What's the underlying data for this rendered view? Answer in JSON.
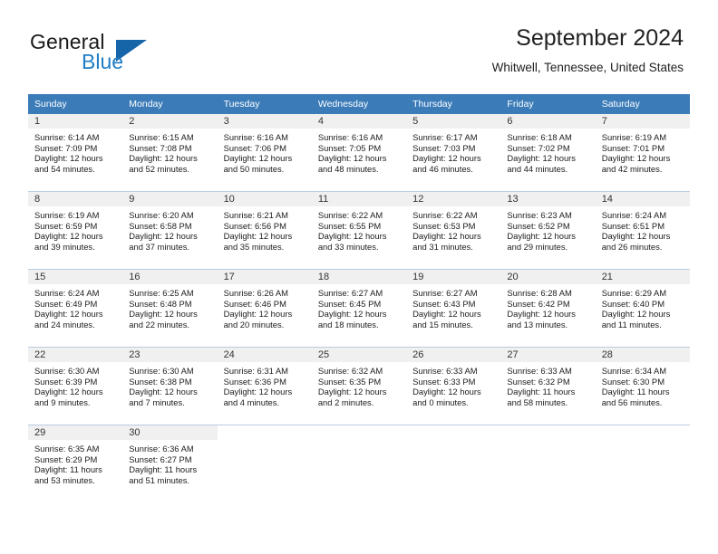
{
  "brand": {
    "word_one": "General",
    "word_two": "Blue",
    "logo_icon": "triangle-logo-icon",
    "accent_color": "#1f7dc4",
    "logo_color": "#1565a8"
  },
  "header": {
    "title": "September 2024",
    "subtitle": "Whitwell, Tennessee, United States"
  },
  "calendar": {
    "header_bg": "#3b7cb8",
    "daynum_bg": "#f0f0f0",
    "grid_line_color": "#b9cde0",
    "weekdays": [
      "Sunday",
      "Monday",
      "Tuesday",
      "Wednesday",
      "Thursday",
      "Friday",
      "Saturday"
    ],
    "weeks": [
      [
        {
          "day": "1",
          "sunrise": "Sunrise: 6:14 AM",
          "sunset": "Sunset: 7:09 PM",
          "daylight_line1": "Daylight: 12 hours",
          "daylight_line2": "and 54 minutes."
        },
        {
          "day": "2",
          "sunrise": "Sunrise: 6:15 AM",
          "sunset": "Sunset: 7:08 PM",
          "daylight_line1": "Daylight: 12 hours",
          "daylight_line2": "and 52 minutes."
        },
        {
          "day": "3",
          "sunrise": "Sunrise: 6:16 AM",
          "sunset": "Sunset: 7:06 PM",
          "daylight_line1": "Daylight: 12 hours",
          "daylight_line2": "and 50 minutes."
        },
        {
          "day": "4",
          "sunrise": "Sunrise: 6:16 AM",
          "sunset": "Sunset: 7:05 PM",
          "daylight_line1": "Daylight: 12 hours",
          "daylight_line2": "and 48 minutes."
        },
        {
          "day": "5",
          "sunrise": "Sunrise: 6:17 AM",
          "sunset": "Sunset: 7:03 PM",
          "daylight_line1": "Daylight: 12 hours",
          "daylight_line2": "and 46 minutes."
        },
        {
          "day": "6",
          "sunrise": "Sunrise: 6:18 AM",
          "sunset": "Sunset: 7:02 PM",
          "daylight_line1": "Daylight: 12 hours",
          "daylight_line2": "and 44 minutes."
        },
        {
          "day": "7",
          "sunrise": "Sunrise: 6:19 AM",
          "sunset": "Sunset: 7:01 PM",
          "daylight_line1": "Daylight: 12 hours",
          "daylight_line2": "and 42 minutes."
        }
      ],
      [
        {
          "day": "8",
          "sunrise": "Sunrise: 6:19 AM",
          "sunset": "Sunset: 6:59 PM",
          "daylight_line1": "Daylight: 12 hours",
          "daylight_line2": "and 39 minutes."
        },
        {
          "day": "9",
          "sunrise": "Sunrise: 6:20 AM",
          "sunset": "Sunset: 6:58 PM",
          "daylight_line1": "Daylight: 12 hours",
          "daylight_line2": "and 37 minutes."
        },
        {
          "day": "10",
          "sunrise": "Sunrise: 6:21 AM",
          "sunset": "Sunset: 6:56 PM",
          "daylight_line1": "Daylight: 12 hours",
          "daylight_line2": "and 35 minutes."
        },
        {
          "day": "11",
          "sunrise": "Sunrise: 6:22 AM",
          "sunset": "Sunset: 6:55 PM",
          "daylight_line1": "Daylight: 12 hours",
          "daylight_line2": "and 33 minutes."
        },
        {
          "day": "12",
          "sunrise": "Sunrise: 6:22 AM",
          "sunset": "Sunset: 6:53 PM",
          "daylight_line1": "Daylight: 12 hours",
          "daylight_line2": "and 31 minutes."
        },
        {
          "day": "13",
          "sunrise": "Sunrise: 6:23 AM",
          "sunset": "Sunset: 6:52 PM",
          "daylight_line1": "Daylight: 12 hours",
          "daylight_line2": "and 29 minutes."
        },
        {
          "day": "14",
          "sunrise": "Sunrise: 6:24 AM",
          "sunset": "Sunset: 6:51 PM",
          "daylight_line1": "Daylight: 12 hours",
          "daylight_line2": "and 26 minutes."
        }
      ],
      [
        {
          "day": "15",
          "sunrise": "Sunrise: 6:24 AM",
          "sunset": "Sunset: 6:49 PM",
          "daylight_line1": "Daylight: 12 hours",
          "daylight_line2": "and 24 minutes."
        },
        {
          "day": "16",
          "sunrise": "Sunrise: 6:25 AM",
          "sunset": "Sunset: 6:48 PM",
          "daylight_line1": "Daylight: 12 hours",
          "daylight_line2": "and 22 minutes."
        },
        {
          "day": "17",
          "sunrise": "Sunrise: 6:26 AM",
          "sunset": "Sunset: 6:46 PM",
          "daylight_line1": "Daylight: 12 hours",
          "daylight_line2": "and 20 minutes."
        },
        {
          "day": "18",
          "sunrise": "Sunrise: 6:27 AM",
          "sunset": "Sunset: 6:45 PM",
          "daylight_line1": "Daylight: 12 hours",
          "daylight_line2": "and 18 minutes."
        },
        {
          "day": "19",
          "sunrise": "Sunrise: 6:27 AM",
          "sunset": "Sunset: 6:43 PM",
          "daylight_line1": "Daylight: 12 hours",
          "daylight_line2": "and 15 minutes."
        },
        {
          "day": "20",
          "sunrise": "Sunrise: 6:28 AM",
          "sunset": "Sunset: 6:42 PM",
          "daylight_line1": "Daylight: 12 hours",
          "daylight_line2": "and 13 minutes."
        },
        {
          "day": "21",
          "sunrise": "Sunrise: 6:29 AM",
          "sunset": "Sunset: 6:40 PM",
          "daylight_line1": "Daylight: 12 hours",
          "daylight_line2": "and 11 minutes."
        }
      ],
      [
        {
          "day": "22",
          "sunrise": "Sunrise: 6:30 AM",
          "sunset": "Sunset: 6:39 PM",
          "daylight_line1": "Daylight: 12 hours",
          "daylight_line2": "and 9 minutes."
        },
        {
          "day": "23",
          "sunrise": "Sunrise: 6:30 AM",
          "sunset": "Sunset: 6:38 PM",
          "daylight_line1": "Daylight: 12 hours",
          "daylight_line2": "and 7 minutes."
        },
        {
          "day": "24",
          "sunrise": "Sunrise: 6:31 AM",
          "sunset": "Sunset: 6:36 PM",
          "daylight_line1": "Daylight: 12 hours",
          "daylight_line2": "and 4 minutes."
        },
        {
          "day": "25",
          "sunrise": "Sunrise: 6:32 AM",
          "sunset": "Sunset: 6:35 PM",
          "daylight_line1": "Daylight: 12 hours",
          "daylight_line2": "and 2 minutes."
        },
        {
          "day": "26",
          "sunrise": "Sunrise: 6:33 AM",
          "sunset": "Sunset: 6:33 PM",
          "daylight_line1": "Daylight: 12 hours",
          "daylight_line2": "and 0 minutes."
        },
        {
          "day": "27",
          "sunrise": "Sunrise: 6:33 AM",
          "sunset": "Sunset: 6:32 PM",
          "daylight_line1": "Daylight: 11 hours",
          "daylight_line2": "and 58 minutes."
        },
        {
          "day": "28",
          "sunrise": "Sunrise: 6:34 AM",
          "sunset": "Sunset: 6:30 PM",
          "daylight_line1": "Daylight: 11 hours",
          "daylight_line2": "and 56 minutes."
        }
      ],
      [
        {
          "day": "29",
          "sunrise": "Sunrise: 6:35 AM",
          "sunset": "Sunset: 6:29 PM",
          "daylight_line1": "Daylight: 11 hours",
          "daylight_line2": "and 53 minutes."
        },
        {
          "day": "30",
          "sunrise": "Sunrise: 6:36 AM",
          "sunset": "Sunset: 6:27 PM",
          "daylight_line1": "Daylight: 11 hours",
          "daylight_line2": "and 51 minutes."
        },
        {
          "day": "",
          "sunrise": "",
          "sunset": "",
          "daylight_line1": "",
          "daylight_line2": ""
        },
        {
          "day": "",
          "sunrise": "",
          "sunset": "",
          "daylight_line1": "",
          "daylight_line2": ""
        },
        {
          "day": "",
          "sunrise": "",
          "sunset": "",
          "daylight_line1": "",
          "daylight_line2": ""
        },
        {
          "day": "",
          "sunrise": "",
          "sunset": "",
          "daylight_line1": "",
          "daylight_line2": ""
        },
        {
          "day": "",
          "sunrise": "",
          "sunset": "",
          "daylight_line1": "",
          "daylight_line2": ""
        }
      ]
    ]
  }
}
